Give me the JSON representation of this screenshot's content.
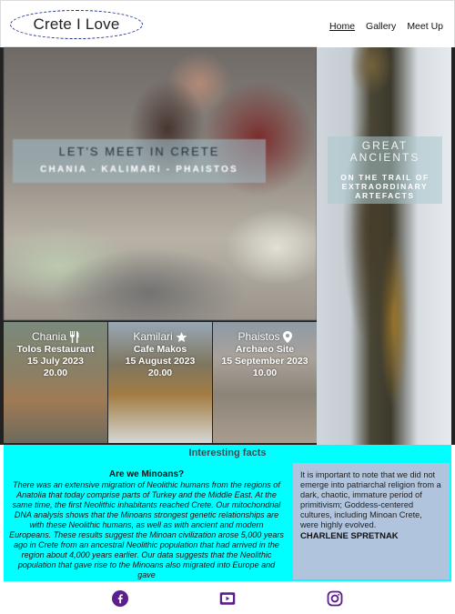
{
  "header": {
    "logo": "Crete I Love",
    "nav": [
      {
        "label": "Home",
        "active": true
      },
      {
        "label": "Gallery",
        "active": false
      },
      {
        "label": "Meet Up",
        "active": false
      }
    ]
  },
  "hero": {
    "main": {
      "title": "LET'S MEET IN CRETE",
      "subtitle": "CHANIA - KALIMARI - PHAISTOS"
    },
    "side": {
      "title_line1": "GREAT",
      "title_line2": "ANCIENTS",
      "subtitle_line1": "ON THE TRAIL OF",
      "subtitle_line2": "EXTRAORDINARY",
      "subtitle_line3": "ARTEFACTS"
    }
  },
  "events": [
    {
      "city": "Chania",
      "icon": "utensils-icon",
      "venue": "Tolos Restaurant",
      "date": "15 July 2023",
      "time": "20.00"
    },
    {
      "city": "Kamilari",
      "icon": "star-icon",
      "venue": "Cafe Makos",
      "date": "15 August 2023",
      "time": "20.00"
    },
    {
      "city": "Phaistos",
      "icon": "map-pin-icon",
      "venue": "Archaeo Site",
      "date": "15 September 2023",
      "time": "10.00"
    }
  ],
  "facts": {
    "heading": "Interesting facts",
    "question": "Are we Minoans?",
    "body": "There was an extensive migration of Neolithic humans from the regions of Anatolia that today comprise parts of Turkey and the Middle East. At the same time, the first Neolithic inhabitants reached Crete. Our mitochondrial DNA analysis shows that the Minoans strongest genetic relationships are with these Neolithic humans, as well as with ancient and modern Europeans. These results suggest the Minoan civilization arose 5,000 years ago in Crete from an ancestral Neolithic population that had arrived in the region about 4,000 years earlier. Our data suggests that the Neolithic population that gave rise to the Minoans also migrated into Europe and gave",
    "quote": "It is important to note that we did not emerge into patriarchal religion from a dark, chaotic, immature period of primitivism; Goddess-centered cultures, including Minoan Crete, were highly evolved.",
    "author": "CHARLENE SPRETNAK"
  },
  "footer": {
    "icons": [
      "facebook-icon",
      "youtube-icon",
      "instagram-icon"
    ],
    "icon_color": "#5b1e8c"
  },
  "colors": {
    "facts_bg": "#00ffff",
    "quote_bg": "#b0c4de",
    "logo_border": "#1c2e8f"
  }
}
